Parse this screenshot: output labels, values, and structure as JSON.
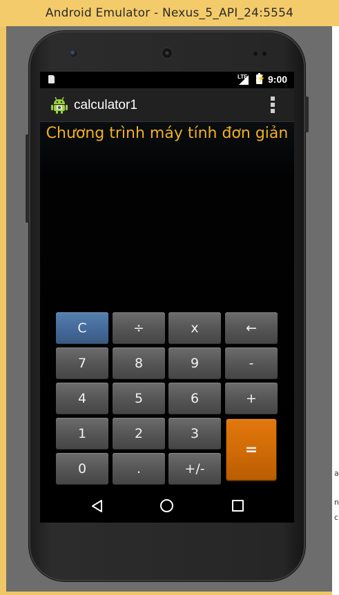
{
  "window": {
    "title": "Android Emulator - Nexus_5_API_24:5554"
  },
  "status_bar": {
    "network": "LTE",
    "time": "9:00",
    "icons": [
      "sd-card-icon",
      "signal-icon",
      "battery-charging-icon"
    ]
  },
  "action_bar": {
    "app_icon": "android-icon",
    "title": "calculator1",
    "menu_icon": "overflow-menu-icon"
  },
  "main": {
    "heading": "Chương trình máy tính đơn giản"
  },
  "keypad": {
    "clear": "C",
    "divide": "÷",
    "multiply": "x",
    "backspace": "←",
    "seven": "7",
    "eight": "8",
    "nine": "9",
    "minus": "-",
    "four": "4",
    "five": "5",
    "six": "6",
    "plus": "+",
    "one": "1",
    "two": "2",
    "three": "3",
    "equals": "=",
    "zero": "0",
    "decimal": ".",
    "negate": "+/-"
  },
  "nav_bar": {
    "icons": [
      "back-icon",
      "home-icon",
      "recents-icon"
    ]
  },
  "background_window": {
    "edge_letters": [
      "a",
      "n",
      "c"
    ]
  },
  "colors": {
    "accent_text": "#f2b01e",
    "clear_button": "#44699a",
    "equals_button": "#cf6a06",
    "window_frame": "#f0c766"
  }
}
